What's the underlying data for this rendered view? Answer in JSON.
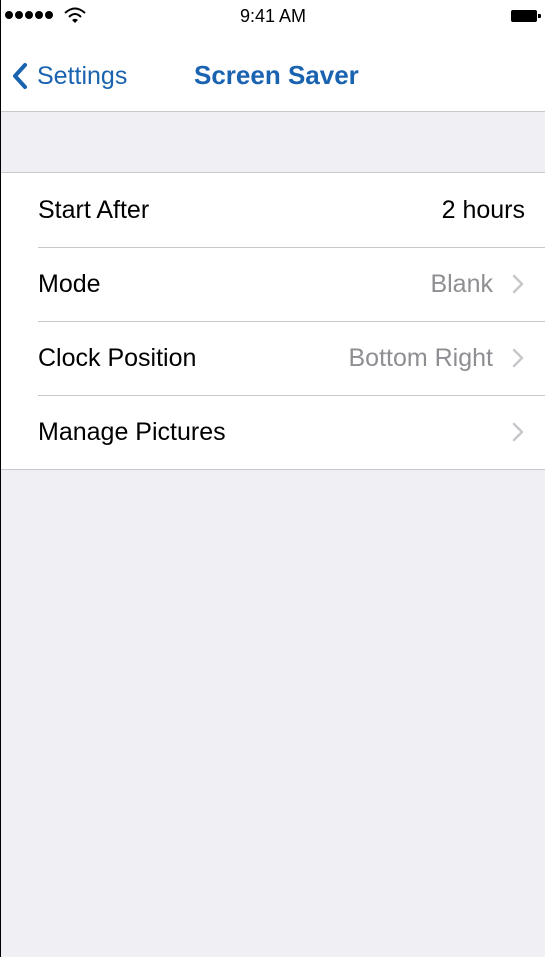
{
  "status_bar": {
    "time": "9:41 AM",
    "signal_icon": "signal-dots-icon",
    "wifi_icon": "wifi-icon",
    "battery_icon": "battery-icon"
  },
  "nav": {
    "back_label": "Settings",
    "back_icon": "chevron-left-icon",
    "title": "Screen Saver",
    "accent_color": "#1a63b0"
  },
  "settings": {
    "rows": [
      {
        "label": "Start After",
        "value": "2 hours",
        "has_chevron": false
      },
      {
        "label": "Mode",
        "value": "Blank",
        "has_chevron": true
      },
      {
        "label": "Clock Position",
        "value": "Bottom Right",
        "has_chevron": true
      },
      {
        "label": "Manage Pictures",
        "value": "",
        "has_chevron": true
      }
    ]
  },
  "colors": {
    "background": "#efeff4",
    "separator": "#c8c7cc",
    "secondary_text": "#8e8e93"
  }
}
